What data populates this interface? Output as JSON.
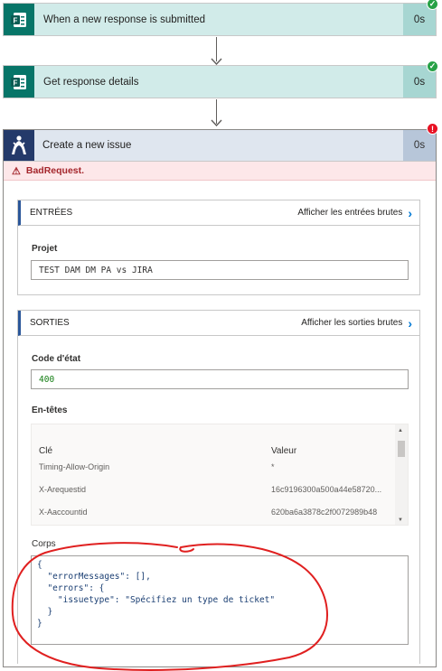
{
  "flow": {
    "steps": [
      {
        "title": "When a new response is submitted",
        "duration": "0s",
        "status": "success"
      },
      {
        "title": "Get response details",
        "duration": "0s",
        "status": "success"
      }
    ],
    "jira": {
      "title": "Create a new issue",
      "duration": "0s",
      "status": "error",
      "error_text": "BadRequest.",
      "inputs": {
        "heading": "ENTRÉES",
        "link": "Afficher les entrées brutes",
        "project_label": "Projet",
        "project_value": "TEST DAM DM PA vs JIRA"
      },
      "outputs": {
        "heading": "SORTIES",
        "link": "Afficher les sorties brutes",
        "status_label": "Code d'état",
        "status_value": "400",
        "headers_label": "En-têtes",
        "headers_columns": {
          "key": "Clé",
          "value": "Valeur"
        },
        "headers_rows": [
          {
            "key": "Timing-Allow-Origin",
            "value": "*"
          },
          {
            "key": "X-Arequestid",
            "value": "16c9196300a500a44e58720..."
          },
          {
            "key": "X-Aaccountid",
            "value": "620ba6a3878c2f0072989b48"
          }
        ],
        "body_label": "Corps",
        "body_lines": [
          "{",
          "  \"errorMessages\": [],",
          "  \"errors\": {",
          "    \"issuetype\": \"Spécifiez un type de ticket\"",
          "  }",
          "}"
        ]
      }
    }
  },
  "colors": {
    "forms_green": "#077568",
    "jira_blue": "#243a6a",
    "success": "#27a146",
    "error": "#e81123",
    "link_chevron": "#0078d4",
    "annotation_red": "#e02020"
  },
  "icons": {
    "forms": "forms-icon",
    "jira": "jira-icon",
    "check": "check-icon",
    "error": "exclamation-icon",
    "warning": "warning-icon",
    "chevron": "chevron-right-icon"
  }
}
